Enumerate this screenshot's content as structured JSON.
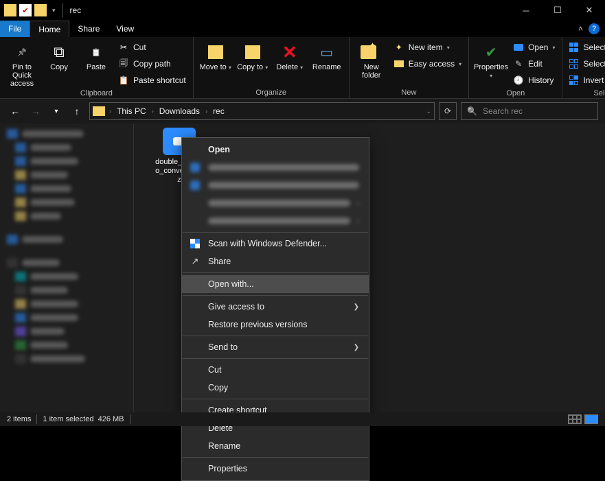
{
  "window": {
    "title": "rec"
  },
  "tabs": {
    "file": "File",
    "home": "Home",
    "share": "Share",
    "view": "View"
  },
  "ribbon": {
    "clipboard": {
      "label": "Clipboard",
      "pin": "Pin to Quick access",
      "copy": "Copy",
      "paste": "Paste",
      "cut": "Cut",
      "copypath": "Copy path",
      "pasteshortcut": "Paste shortcut"
    },
    "organize": {
      "label": "Organize",
      "moveto": "Move to",
      "copyto": "Copy to",
      "delete": "Delete",
      "rename": "Rename"
    },
    "new": {
      "label": "New",
      "newfolder": "New folder",
      "newitem": "New item",
      "easyaccess": "Easy access"
    },
    "open": {
      "label": "Open",
      "properties": "Properties",
      "open": "Open",
      "edit": "Edit",
      "history": "History"
    },
    "select": {
      "label": "Select",
      "all": "Select all",
      "none": "Select none",
      "invert": "Invert selection"
    }
  },
  "address": {
    "crumbs": [
      "This PC",
      "Downloads",
      "rec"
    ],
    "search_placeholder": "Search rec"
  },
  "files": {
    "item1": "double_click_to_convert_01.z"
  },
  "context_menu": {
    "open": "Open",
    "scan": "Scan with Windows Defender...",
    "share": "Share",
    "openwith": "Open with...",
    "giveaccess": "Give access to",
    "restore": "Restore previous versions",
    "sendto": "Send to",
    "cut": "Cut",
    "copy": "Copy",
    "createshortcut": "Create shortcut",
    "delete": "Delete",
    "rename": "Rename",
    "properties": "Properties"
  },
  "status": {
    "items": "2 items",
    "selected": "1 item selected",
    "size": "426 MB"
  }
}
